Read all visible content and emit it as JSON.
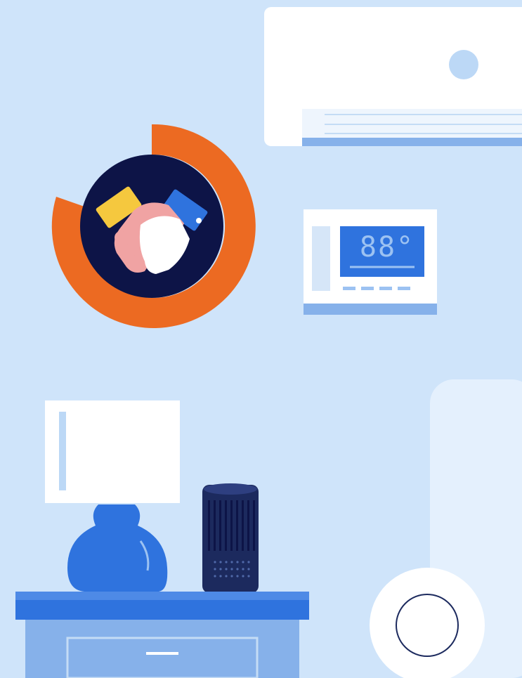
{
  "scene": {
    "thermostat": {
      "display_value": "88°"
    },
    "icons": {
      "handshake": "handshake-icon",
      "air_conditioner": "air-conditioner-icon",
      "thermostat": "thermostat-icon",
      "lamp": "table-lamp-icon",
      "smart_speaker": "smart-speaker-icon",
      "nightstand": "nightstand-icon",
      "smart_home_hub": "smart-hub-icon"
    },
    "colors": {
      "background": "#cfe4fa",
      "accent_orange": "#ec6a22",
      "navy": "#0d1447",
      "blue": "#2f73de",
      "light_blue": "#8fb8ec",
      "white": "#ffffff"
    }
  }
}
